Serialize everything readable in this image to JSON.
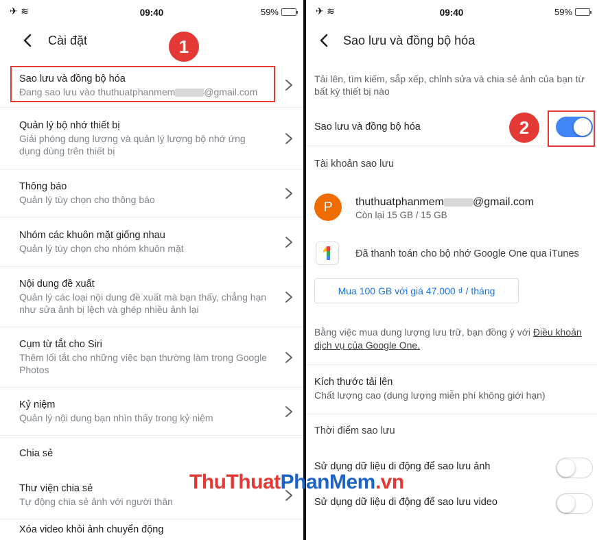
{
  "status_bar": {
    "left_icons": "✈ ≋",
    "time": "09:40",
    "battery": "59%",
    "battery_level": 0.59
  },
  "left_panel": {
    "title": "Cài đặt",
    "badge": "1",
    "items": [
      {
        "title": "Sao lưu và đồng bộ hóa",
        "subtitle_prefix": "Đang sao lưu vào thuthuatphanmem",
        "subtitle_suffix": "@gmail.com"
      },
      {
        "title": "Quản lý bộ nhớ thiết bị",
        "subtitle": "Giải phóng dung lượng và quản lý lượng bộ nhớ ứng dụng dùng trên thiết bị"
      },
      {
        "title": "Thông báo",
        "subtitle": "Quản lý tùy chọn cho thông báo"
      },
      {
        "title": "Nhóm các khuôn mặt giống nhau",
        "subtitle": "Quản lý tùy chọn cho nhóm khuôn mặt"
      },
      {
        "title": "Nội dung đề xuất",
        "subtitle": "Quản lý các loại nội dung đề xuất mà bạn thấy, chẳng hạn như sửa ảnh bị lệch và ghép nhiều ảnh lại"
      },
      {
        "title": "Cụm từ tắt cho Siri",
        "subtitle": "Thêm lối tắt cho những việc bạn thường làm trong Google Photos"
      },
      {
        "title": "Kỷ niệm",
        "subtitle": "Quản lý nội dung bạn nhìn thấy trong kỷ niệm"
      }
    ],
    "section_share": "Chia sẻ",
    "shared_library": {
      "title": "Thư viện chia sẻ",
      "subtitle": "Tự động chia sẻ ảnh với người thân"
    },
    "remove_video": {
      "title": "Xóa video khỏi ảnh chuyển động"
    }
  },
  "right_panel": {
    "title": "Sao lưu và đồng bộ hóa",
    "badge": "2",
    "description": "Tải lên, tìm kiếm, sắp xếp, chỉnh sửa và chia sẻ ảnh của bạn từ bất kỳ thiết bị nào",
    "backup_toggle_label": "Sao lưu và đồng bộ hóa",
    "backup_toggle_on": true,
    "account_section": "Tài khoản sao lưu",
    "avatar_letter": "P",
    "account_email_prefix": "thuthuatphanmem",
    "account_email_suffix": "@gmail.com",
    "account_storage": "Còn lại 15 GB / 15 GB",
    "google_one_logo": "1",
    "google_one_text": "Đã thanh toán cho bộ nhớ Google One qua iTunes",
    "buy_button": "Mua 100 GB với giá 47.000 ₫ / tháng",
    "terms_text": "Bằng việc mua dung lượng lưu trữ, bạn đồng ý với ",
    "terms_link": "Điều khoản dịch vụ của Google One.",
    "upload_size_title": "Kích thước tải lên",
    "upload_size_value": "Chất lượng cao (dung lượng miễn phí không giới hạn)",
    "backup_time_section": "Thời điểm sao lưu",
    "mobile_photo_label": "Sử dụng dữ liệu di động để sao lưu ảnh",
    "mobile_photo_on": false,
    "mobile_video_label": "Sử dụng dữ liệu di động để sao lưu video",
    "mobile_video_on": false
  },
  "watermark": {
    "part1": "ThuThuat",
    "part2": "PhanMem",
    "part3": ".vn"
  },
  "colors": {
    "accent_blue": "#4285f4",
    "highlight_red": "#e53935",
    "avatar_orange": "#ef6c00",
    "link_blue": "#1a73e8"
  }
}
